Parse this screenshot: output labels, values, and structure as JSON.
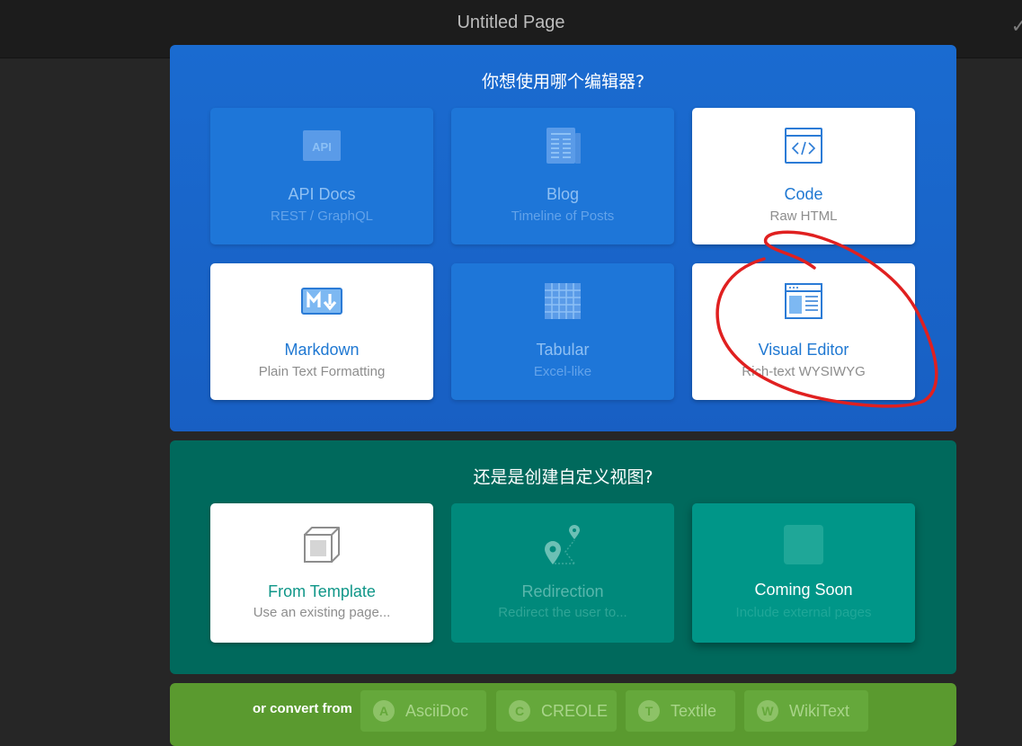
{
  "topbar": {
    "title": "Untitled Page",
    "check": "✓"
  },
  "editor_panel": {
    "heading": "你想使用哪个编辑器?",
    "cards": [
      {
        "title": "API Docs",
        "subtitle": "REST / GraphQL",
        "icon": "api-icon",
        "enabled": false
      },
      {
        "title": "Blog",
        "subtitle": "Timeline of Posts",
        "icon": "newspaper-icon",
        "enabled": false
      },
      {
        "title": "Code",
        "subtitle": "Raw HTML",
        "icon": "code-window-icon",
        "enabled": true
      },
      {
        "title": "Markdown",
        "subtitle": "Plain Text Formatting",
        "icon": "markdown-icon",
        "enabled": true
      },
      {
        "title": "Tabular",
        "subtitle": "Excel-like",
        "icon": "grid-icon",
        "enabled": false
      },
      {
        "title": "Visual Editor",
        "subtitle": "Rich-text WYSIWYG",
        "icon": "layout-icon",
        "enabled": true
      }
    ]
  },
  "custom_panel": {
    "heading": "还是是创建自定义视图?",
    "cards": [
      {
        "title": "From Template",
        "subtitle": "Use an existing page...",
        "icon": "cube-icon",
        "enabled": true
      },
      {
        "title": "Redirection",
        "subtitle": "Redirect the user to...",
        "icon": "route-pins-icon",
        "enabled": false
      },
      {
        "title": "Coming Soon",
        "subtitle": "Include external pages",
        "icon": "placeholder-icon",
        "enabled": false
      }
    ]
  },
  "convert_panel": {
    "label": "or convert from",
    "chips": [
      {
        "badge": "A",
        "label": "AsciiDoc"
      },
      {
        "badge": "C",
        "label": "CREOLE"
      },
      {
        "badge": "T",
        "label": "Textile"
      },
      {
        "badge": "W",
        "label": "WikiText"
      }
    ]
  },
  "colors": {
    "editor_panel": "#1a6bd0",
    "custom_panel": "#00695c",
    "convert_panel": "#5a9a2f",
    "annotation_stroke": "#e02020"
  }
}
